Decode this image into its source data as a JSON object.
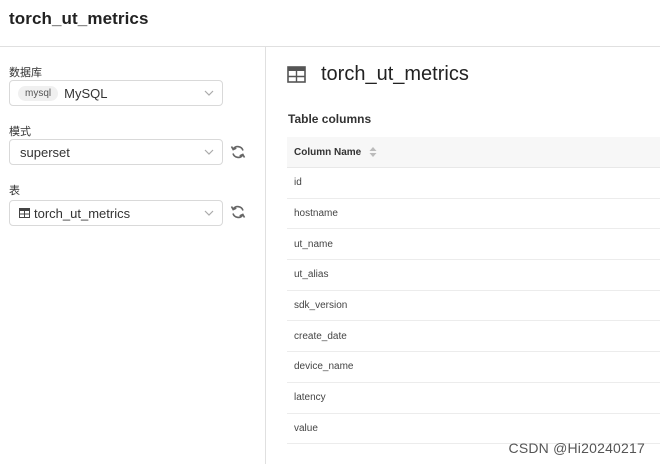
{
  "header": {
    "title": "torch_ut_metrics"
  },
  "sidebar": {
    "database": {
      "label": "数据库",
      "badge": "mysql",
      "value": "MySQL"
    },
    "schema": {
      "label": "模式",
      "value": "superset"
    },
    "table": {
      "label": "表",
      "value": "torch_ut_metrics"
    }
  },
  "main": {
    "title": "torch_ut_metrics",
    "section_title": "Table columns",
    "column_header": "Column Name",
    "columns": [
      "id",
      "hostname",
      "ut_name",
      "ut_alias",
      "sdk_version",
      "create_date",
      "device_name",
      "latency",
      "value"
    ]
  },
  "watermark": "CSDN @Hi20240217",
  "colors": {
    "border": "#d9d9d9",
    "header_bg": "#f7f7f7",
    "icon": "#666666"
  },
  "icons": [
    "chevron-down-icon",
    "refresh-icon",
    "table-icon",
    "sort-icon"
  ]
}
